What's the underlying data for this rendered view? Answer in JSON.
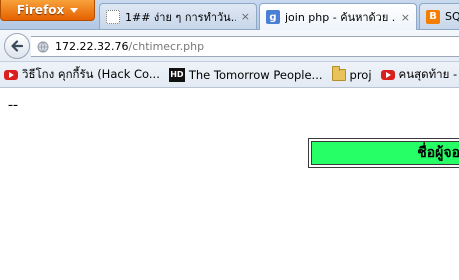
{
  "browser": {
    "app_button_label": "Firefox",
    "tabs": [
      {
        "title": "1## ง่าย ๆ การทำวัน...",
        "icon": "dotted-page-icon",
        "close": "×",
        "active": false
      },
      {
        "title": "join php - ค้นหาด้วย ...",
        "icon": "google-icon",
        "close": "×",
        "active": true
      },
      {
        "title": "SQL",
        "icon": "blogger-icon",
        "active": false
      }
    ],
    "url": {
      "host": "172.22.32.76",
      "path": "/chtimecr.php"
    },
    "bookmarks": [
      {
        "label": "วิธีโกง คุกกี้รัน (Hack Co...",
        "icon": "youtube-icon"
      },
      {
        "label": "The Tomorrow People...",
        "icon": "hd-icon"
      },
      {
        "label": "proj",
        "icon": "folder-icon"
      },
      {
        "label": "คนสุดท้าย - Yo",
        "icon": "youtube-icon"
      }
    ]
  },
  "page": {
    "dashes": "--",
    "table_header": "ชื่อผู้จอ"
  },
  "colors": {
    "firefox_orange": "#e66000",
    "header_green": "#26ff66",
    "google_blue": "#4a7fd6",
    "blogger_orange": "#f57d00",
    "youtube_red": "#d9201f"
  }
}
